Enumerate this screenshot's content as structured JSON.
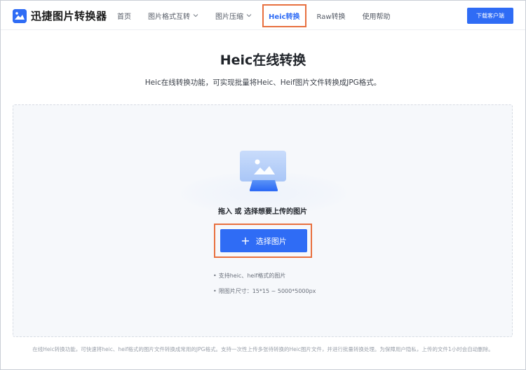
{
  "header": {
    "logo_text": "迅捷图片转换器",
    "nav": [
      {
        "label": "首页",
        "dropdown": false
      },
      {
        "label": "图片格式互转",
        "dropdown": true
      },
      {
        "label": "图片压缩",
        "dropdown": true
      },
      {
        "label": "Heic转换",
        "dropdown": false,
        "active": true
      },
      {
        "label": "Raw转换",
        "dropdown": false
      },
      {
        "label": "使用帮助",
        "dropdown": false
      }
    ],
    "download_label": "下载客户端"
  },
  "main": {
    "title": "Heic在线转换",
    "subtitle": "Heic在线转换功能，可实现批量将Heic、Heif图片文件转换成JPG格式。"
  },
  "upload": {
    "drop_text": "拖入 或 选择想要上传的图片",
    "select_label": "选择图片",
    "notes": [
      "支持heic、heif格式的图片",
      "限图片尺寸：15*15 ~ 5000*5000px"
    ]
  },
  "footer": {
    "text": "在线Heic转换功能，可快速将heic、heif格式的图片文件转换成常用的JPG格式。支持一次性上传多张待转换的Heic图片文件，并进行批量转换处理。为保障用户隐私，上传的文件1小时会自动删除。"
  },
  "colors": {
    "accent": "#2f6cf5",
    "highlight_border": "#e8703f"
  }
}
